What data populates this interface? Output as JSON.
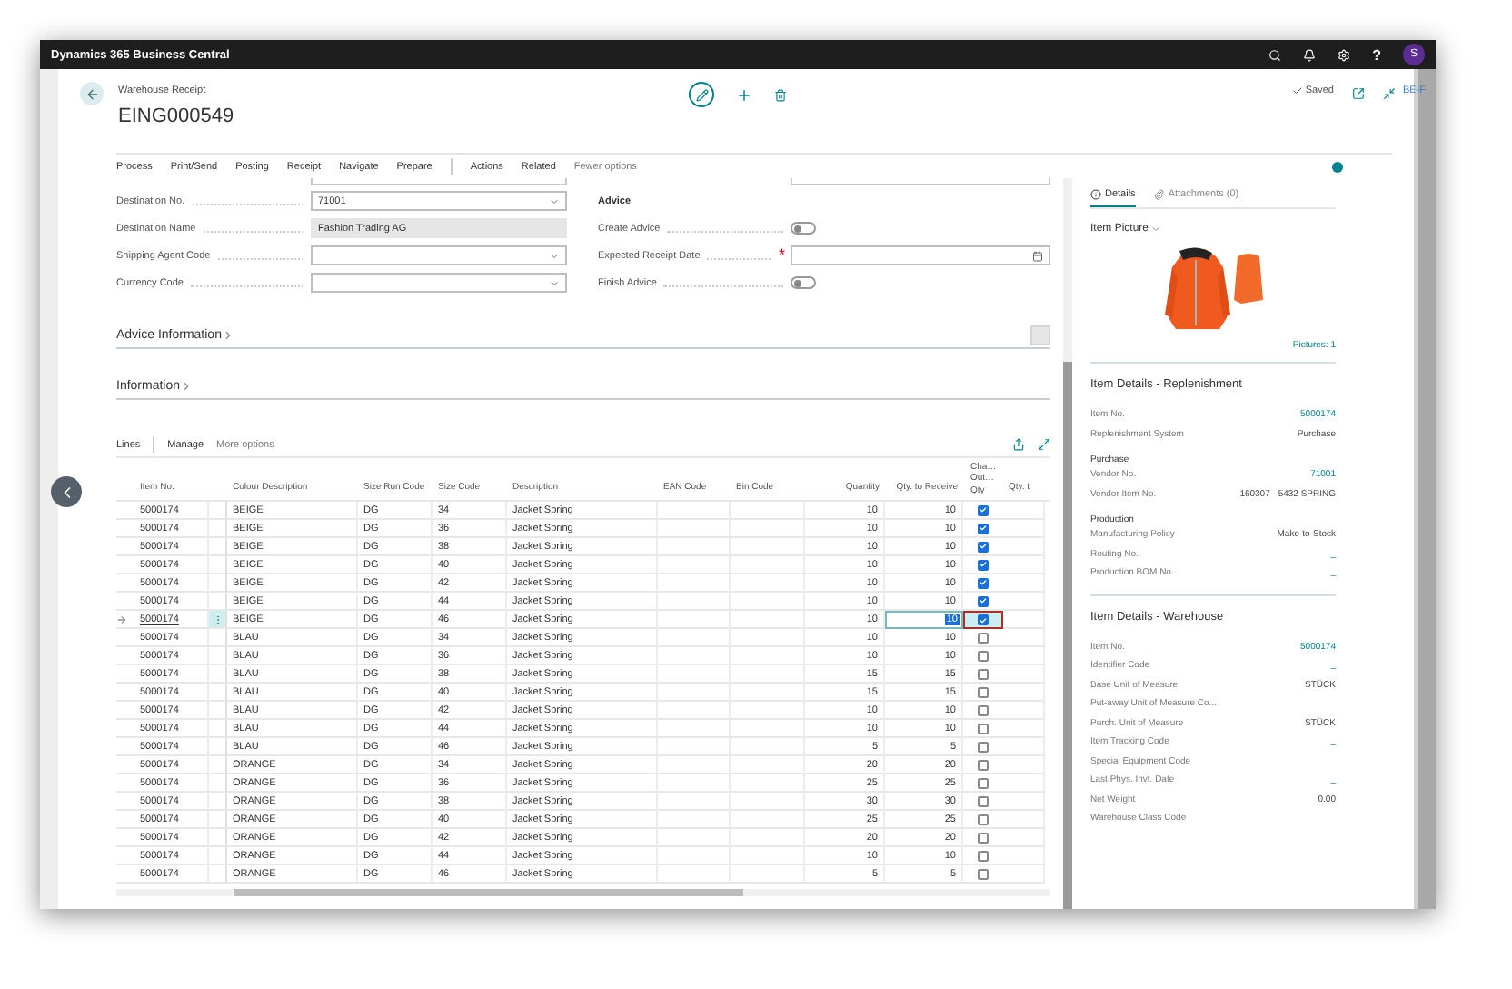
{
  "top_bar": {
    "title": "Dynamics 365 Business Central",
    "help": "?",
    "avatar": "S"
  },
  "side_label": "BE-F",
  "header": {
    "page_type": "Warehouse Receipt",
    "title": "EING000549",
    "status": "Saved"
  },
  "action_bar": {
    "primary": [
      "Process",
      "Print/Send",
      "Posting",
      "Receipt",
      "Navigate",
      "Prepare"
    ],
    "secondary": [
      "Actions",
      "Related"
    ],
    "more": "Fewer options"
  },
  "form": {
    "left_fields": [
      {
        "label": "Destination No.",
        "value": "71001",
        "kind": "select"
      },
      {
        "label": "Destination Name",
        "value": "Fashion Trading AG",
        "kind": "readonly"
      },
      {
        "label": "Shipping Agent Code",
        "kind": "select"
      },
      {
        "label": "Currency Code",
        "kind": "select"
      }
    ],
    "advice": {
      "title": "Advice",
      "fields": [
        {
          "label": "Create Advice",
          "kind": "toggle",
          "on": false
        },
        {
          "label": "Expected Receipt Date",
          "kind": "date",
          "required_mark": "*"
        },
        {
          "label": "Finish Advice",
          "kind": "toggle",
          "on": false
        }
      ]
    }
  },
  "fasttabs": [
    {
      "title": "Advice Information",
      "kind": "boxed",
      "expanded": false
    },
    {
      "title": "Information",
      "kind": "plain",
      "expanded": false
    }
  ],
  "lines": {
    "title": "Lines",
    "manage": "Manage",
    "more": "More options",
    "columns": [
      "Item No.",
      "Colour Description",
      "Size Run Code",
      "Size Code",
      "Description",
      "EAN Code",
      "Bin Code",
      "Quantity",
      "Qty. to Receive",
      "Cha… Out… Qty",
      "Qty. t"
    ],
    "rows": [
      {
        "item_no": "5000174",
        "colour": "BEIGE",
        "size_run": "DG",
        "size": "34",
        "description": "Jacket Spring",
        "quantity": "10",
        "qty_to_receive": "10",
        "checked": true,
        "selected": false
      },
      {
        "item_no": "5000174",
        "colour": "BEIGE",
        "size_run": "DG",
        "size": "36",
        "description": "Jacket Spring",
        "quantity": "10",
        "qty_to_receive": "10",
        "checked": true,
        "selected": false
      },
      {
        "item_no": "5000174",
        "colour": "BEIGE",
        "size_run": "DG",
        "size": "38",
        "description": "Jacket Spring",
        "quantity": "10",
        "qty_to_receive": "10",
        "checked": true,
        "selected": false
      },
      {
        "item_no": "5000174",
        "colour": "BEIGE",
        "size_run": "DG",
        "size": "40",
        "description": "Jacket Spring",
        "quantity": "10",
        "qty_to_receive": "10",
        "checked": true,
        "selected": false
      },
      {
        "item_no": "5000174",
        "colour": "BEIGE",
        "size_run": "DG",
        "size": "42",
        "description": "Jacket Spring",
        "quantity": "10",
        "qty_to_receive": "10",
        "checked": true,
        "selected": false
      },
      {
        "item_no": "5000174",
        "colour": "BEIGE",
        "size_run": "DG",
        "size": "44",
        "description": "Jacket Spring",
        "quantity": "10",
        "qty_to_receive": "10",
        "checked": true,
        "selected": false
      },
      {
        "item_no": "5000174",
        "colour": "BEIGE",
        "size_run": "DG",
        "size": "46",
        "description": "Jacket Spring",
        "quantity": "10",
        "qty_to_receive": "10",
        "checked": true,
        "selected": true
      },
      {
        "item_no": "5000174",
        "colour": "BLAU",
        "size_run": "DG",
        "size": "34",
        "description": "Jacket Spring",
        "quantity": "10",
        "qty_to_receive": "10",
        "checked": false,
        "selected": false
      },
      {
        "item_no": "5000174",
        "colour": "BLAU",
        "size_run": "DG",
        "size": "36",
        "description": "Jacket Spring",
        "quantity": "10",
        "qty_to_receive": "10",
        "checked": false,
        "selected": false
      },
      {
        "item_no": "5000174",
        "colour": "BLAU",
        "size_run": "DG",
        "size": "38",
        "description": "Jacket Spring",
        "quantity": "15",
        "qty_to_receive": "15",
        "checked": false,
        "selected": false
      },
      {
        "item_no": "5000174",
        "colour": "BLAU",
        "size_run": "DG",
        "size": "40",
        "description": "Jacket Spring",
        "quantity": "15",
        "qty_to_receive": "15",
        "checked": false,
        "selected": false
      },
      {
        "item_no": "5000174",
        "colour": "BLAU",
        "size_run": "DG",
        "size": "42",
        "description": "Jacket Spring",
        "quantity": "10",
        "qty_to_receive": "10",
        "checked": false,
        "selected": false
      },
      {
        "item_no": "5000174",
        "colour": "BLAU",
        "size_run": "DG",
        "size": "44",
        "description": "Jacket Spring",
        "quantity": "10",
        "qty_to_receive": "10",
        "checked": false,
        "selected": false
      },
      {
        "item_no": "5000174",
        "colour": "BLAU",
        "size_run": "DG",
        "size": "46",
        "description": "Jacket Spring",
        "quantity": "5",
        "qty_to_receive": "5",
        "checked": false,
        "selected": false
      },
      {
        "item_no": "5000174",
        "colour": "ORANGE",
        "size_run": "DG",
        "size": "34",
        "description": "Jacket Spring",
        "quantity": "20",
        "qty_to_receive": "20",
        "checked": false,
        "selected": false
      },
      {
        "item_no": "5000174",
        "colour": "ORANGE",
        "size_run": "DG",
        "size": "36",
        "description": "Jacket Spring",
        "quantity": "25",
        "qty_to_receive": "25",
        "checked": false,
        "selected": false
      },
      {
        "item_no": "5000174",
        "colour": "ORANGE",
        "size_run": "DG",
        "size": "38",
        "description": "Jacket Spring",
        "quantity": "30",
        "qty_to_receive": "30",
        "checked": false,
        "selected": false
      },
      {
        "item_no": "5000174",
        "colour": "ORANGE",
        "size_run": "DG",
        "size": "40",
        "description": "Jacket Spring",
        "quantity": "25",
        "qty_to_receive": "25",
        "checked": false,
        "selected": false
      },
      {
        "item_no": "5000174",
        "colour": "ORANGE",
        "size_run": "DG",
        "size": "42",
        "description": "Jacket Spring",
        "quantity": "20",
        "qty_to_receive": "20",
        "checked": false,
        "selected": false
      },
      {
        "item_no": "5000174",
        "colour": "ORANGE",
        "size_run": "DG",
        "size": "44",
        "description": "Jacket Spring",
        "quantity": "10",
        "qty_to_receive": "10",
        "checked": false,
        "selected": false
      },
      {
        "item_no": "5000174",
        "colour": "ORANGE",
        "size_run": "DG",
        "size": "46",
        "description": "Jacket Spring",
        "quantity": "5",
        "qty_to_receive": "5",
        "checked": false,
        "selected": false
      }
    ]
  },
  "fact_box": {
    "tabs": [
      {
        "label": "Details",
        "kind": "info",
        "selected": true
      },
      {
        "label": "Attachments (0)",
        "kind": "attachment",
        "selected": false
      }
    ],
    "picture": {
      "title": "Item Picture",
      "link": "Pictures: 1"
    },
    "sections": [
      {
        "title": "Item Details - Replenishment",
        "rows": [
          {
            "kind": "field",
            "label": "Item No.",
            "value": "5000174",
            "link": true
          },
          {
            "kind": "field",
            "label": "Replenishment System",
            "value": "Purchase",
            "link": false
          },
          {
            "kind": "heading",
            "label": "Purchase"
          },
          {
            "kind": "field",
            "label": "Vendor No.",
            "value": "71001",
            "link": true
          },
          {
            "kind": "field",
            "label": "Vendor Item No.",
            "value": "160307 - 5432 SPRING",
            "link": false
          },
          {
            "kind": "heading",
            "label": "Production"
          },
          {
            "kind": "field",
            "label": "Manufacturing Policy",
            "value": "Make-to-Stock",
            "link": false
          },
          {
            "kind": "field",
            "label": "Routing No.",
            "value": "_",
            "link": true
          },
          {
            "kind": "field",
            "label": "Production BOM No.",
            "value": "_",
            "link": true
          }
        ]
      },
      {
        "title": "Item Details - Warehouse",
        "rows": [
          {
            "kind": "field",
            "label": "Item No.",
            "value": "5000174",
            "link": true
          },
          {
            "kind": "field",
            "label": "Identifier Code",
            "value": "_",
            "link": true
          },
          {
            "kind": "field",
            "label": "Base Unit of Measure",
            "value": "STÜCK",
            "link": false
          },
          {
            "kind": "field",
            "label": "Put-away Unit of Measure Co..."
          },
          {
            "kind": "field",
            "label": "Purch. Unit of Measure",
            "value": "STÜCK",
            "link": false
          },
          {
            "kind": "field",
            "label": "Item Tracking Code",
            "value": "_",
            "link": true
          },
          {
            "kind": "field",
            "label": "Special Equipment Code"
          },
          {
            "kind": "field",
            "label": "Last Phys. Invt. Date",
            "value": "_",
            "link": true
          },
          {
            "kind": "field",
            "label": "Net Weight",
            "value": "0.00",
            "link": false
          },
          {
            "kind": "field",
            "label": "Warehouse Class Code"
          }
        ]
      }
    ]
  }
}
